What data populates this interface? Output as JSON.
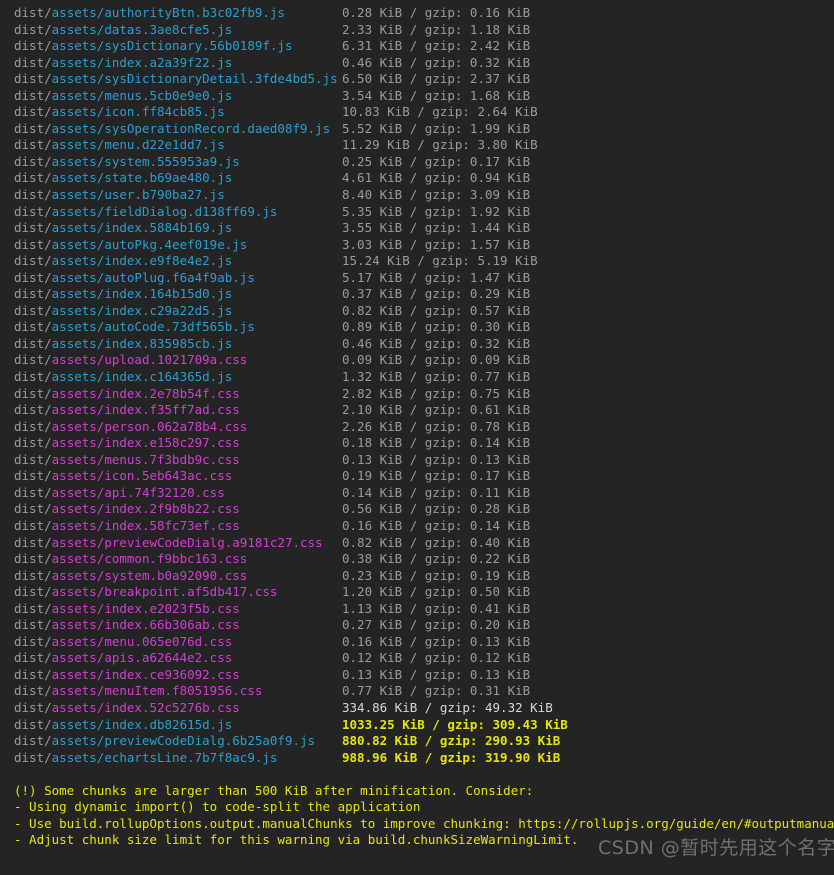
{
  "terminal": {
    "background": "#242424",
    "colors": {
      "dim": "#9b9b9b",
      "js": "#2a9fd0",
      "css": "#d13fd1",
      "size": "#9b9b9b",
      "size_big": "#d8d8d8",
      "size_warn": "#e5e510",
      "warning": "#e5e510"
    },
    "prefix": "dist/",
    "dir": "assets/",
    "assets": [
      {
        "file": "authorityBtn.b3c02fb9.js",
        "kind": "js",
        "size": "0.28 KiB / gzip: 0.16 KiB",
        "level": "normal"
      },
      {
        "file": "datas.3ae8cfe5.js",
        "kind": "js",
        "size": "2.33 KiB / gzip: 1.18 KiB",
        "level": "normal"
      },
      {
        "file": "sysDictionary.56b0189f.js",
        "kind": "js",
        "size": "6.31 KiB / gzip: 2.42 KiB",
        "level": "normal"
      },
      {
        "file": "index.a2a39f22.js",
        "kind": "js",
        "size": "0.46 KiB / gzip: 0.32 KiB",
        "level": "normal"
      },
      {
        "file": "sysDictionaryDetail.3fde4bd5.js",
        "kind": "js",
        "size": "6.50 KiB / gzip: 2.37 KiB",
        "level": "normal"
      },
      {
        "file": "menus.5cb0e9e0.js",
        "kind": "js",
        "size": "3.54 KiB / gzip: 1.68 KiB",
        "level": "normal"
      },
      {
        "file": "icon.ff84cb85.js",
        "kind": "js",
        "size": "10.83 KiB / gzip: 2.64 KiB",
        "level": "normal"
      },
      {
        "file": "sysOperationRecord.daed08f9.js",
        "kind": "js",
        "size": "5.52 KiB / gzip: 1.99 KiB",
        "level": "normal"
      },
      {
        "file": "menu.d22e1dd7.js",
        "kind": "js",
        "size": "11.29 KiB / gzip: 3.80 KiB",
        "level": "normal"
      },
      {
        "file": "system.555953a9.js",
        "kind": "js",
        "size": "0.25 KiB / gzip: 0.17 KiB",
        "level": "normal"
      },
      {
        "file": "state.b69ae480.js",
        "kind": "js",
        "size": "4.61 KiB / gzip: 0.94 KiB",
        "level": "normal"
      },
      {
        "file": "user.b790ba27.js",
        "kind": "js",
        "size": "8.40 KiB / gzip: 3.09 KiB",
        "level": "normal"
      },
      {
        "file": "fieldDialog.d138ff69.js",
        "kind": "js",
        "size": "5.35 KiB / gzip: 1.92 KiB",
        "level": "normal"
      },
      {
        "file": "index.5884b169.js",
        "kind": "js",
        "size": "3.55 KiB / gzip: 1.44 KiB",
        "level": "normal"
      },
      {
        "file": "autoPkg.4eef019e.js",
        "kind": "js",
        "size": "3.03 KiB / gzip: 1.57 KiB",
        "level": "normal"
      },
      {
        "file": "index.e9f8e4e2.js",
        "kind": "js",
        "size": "15.24 KiB / gzip: 5.19 KiB",
        "level": "normal"
      },
      {
        "file": "autoPlug.f6a4f9ab.js",
        "kind": "js",
        "size": "5.17 KiB / gzip: 1.47 KiB",
        "level": "normal"
      },
      {
        "file": "index.164b15d0.js",
        "kind": "js",
        "size": "0.37 KiB / gzip: 0.29 KiB",
        "level": "normal"
      },
      {
        "file": "index.c29a22d5.js",
        "kind": "js",
        "size": "0.82 KiB / gzip: 0.57 KiB",
        "level": "normal"
      },
      {
        "file": "autoCode.73df565b.js",
        "kind": "js",
        "size": "0.89 KiB / gzip: 0.30 KiB",
        "level": "normal"
      },
      {
        "file": "index.835985cb.js",
        "kind": "js",
        "size": "0.46 KiB / gzip: 0.32 KiB",
        "level": "normal"
      },
      {
        "file": "upload.1021709a.css",
        "kind": "css",
        "size": "0.09 KiB / gzip: 0.09 KiB",
        "level": "normal"
      },
      {
        "file": "index.c164365d.js",
        "kind": "js",
        "size": "1.32 KiB / gzip: 0.77 KiB",
        "level": "normal"
      },
      {
        "file": "index.2e78b54f.css",
        "kind": "css",
        "size": "2.82 KiB / gzip: 0.75 KiB",
        "level": "normal"
      },
      {
        "file": "index.f35ff7ad.css",
        "kind": "css",
        "size": "2.10 KiB / gzip: 0.61 KiB",
        "level": "normal"
      },
      {
        "file": "person.062a78b4.css",
        "kind": "css",
        "size": "2.26 KiB / gzip: 0.78 KiB",
        "level": "normal"
      },
      {
        "file": "index.e158c297.css",
        "kind": "css",
        "size": "0.18 KiB / gzip: 0.14 KiB",
        "level": "normal"
      },
      {
        "file": "menus.7f3bdb9c.css",
        "kind": "css",
        "size": "0.13 KiB / gzip: 0.13 KiB",
        "level": "normal"
      },
      {
        "file": "icon.5eb643ac.css",
        "kind": "css",
        "size": "0.19 KiB / gzip: 0.17 KiB",
        "level": "normal"
      },
      {
        "file": "api.74f32120.css",
        "kind": "css",
        "size": "0.14 KiB / gzip: 0.11 KiB",
        "level": "normal"
      },
      {
        "file": "index.2f9b8b22.css",
        "kind": "css",
        "size": "0.56 KiB / gzip: 0.28 KiB",
        "level": "normal"
      },
      {
        "file": "index.58fc73ef.css",
        "kind": "css",
        "size": "0.16 KiB / gzip: 0.14 KiB",
        "level": "normal"
      },
      {
        "file": "previewCodeDialg.a9181c27.css",
        "kind": "css",
        "size": "0.82 KiB / gzip: 0.40 KiB",
        "level": "normal"
      },
      {
        "file": "common.f9bbc163.css",
        "kind": "css",
        "size": "0.38 KiB / gzip: 0.22 KiB",
        "level": "normal"
      },
      {
        "file": "system.b0a92090.css",
        "kind": "css",
        "size": "0.23 KiB / gzip: 0.19 KiB",
        "level": "normal"
      },
      {
        "file": "breakpoint.af5db417.css",
        "kind": "css",
        "size": "1.20 KiB / gzip: 0.50 KiB",
        "level": "normal"
      },
      {
        "file": "index.e2023f5b.css",
        "kind": "css",
        "size": "1.13 KiB / gzip: 0.41 KiB",
        "level": "normal"
      },
      {
        "file": "index.66b306ab.css",
        "kind": "css",
        "size": "0.27 KiB / gzip: 0.20 KiB",
        "level": "normal"
      },
      {
        "file": "menu.065e076d.css",
        "kind": "css",
        "size": "0.16 KiB / gzip: 0.13 KiB",
        "level": "normal"
      },
      {
        "file": "apis.a62644e2.css",
        "kind": "css",
        "size": "0.12 KiB / gzip: 0.12 KiB",
        "level": "normal"
      },
      {
        "file": "index.ce936092.css",
        "kind": "css",
        "size": "0.13 KiB / gzip: 0.13 KiB",
        "level": "normal"
      },
      {
        "file": "menuItem.f8051956.css",
        "kind": "css",
        "size": "0.77 KiB / gzip: 0.31 KiB",
        "level": "normal"
      },
      {
        "file": "index.52c5276b.css",
        "kind": "css",
        "size": "334.86 KiB / gzip: 49.32 KiB",
        "level": "large"
      },
      {
        "file": "index.db82615d.js",
        "kind": "js",
        "size": "1033.25 KiB / gzip: 309.43 KiB",
        "level": "warn"
      },
      {
        "file": "previewCodeDialg.6b25a0f9.js",
        "kind": "js",
        "size": "880.82 KiB / gzip: 290.93 KiB",
        "level": "warn"
      },
      {
        "file": "echartsLine.7b7f8ac9.js",
        "kind": "js",
        "size": "988.96 KiB / gzip: 319.90 KiB",
        "level": "warn"
      }
    ],
    "warnings": [
      "(!) Some chunks are larger than 500 KiB after minification. Consider:",
      "- Using dynamic import() to code-split the application",
      "- Use build.rollupOptions.output.manualChunks to improve chunking: https://rollupjs.org/guide/en/#outputmanualchunks",
      "- Adjust chunk size limit for this warning via build.chunkSizeWarningLimit."
    ],
    "watermark": "CSDN @暂时先用这个名字"
  }
}
